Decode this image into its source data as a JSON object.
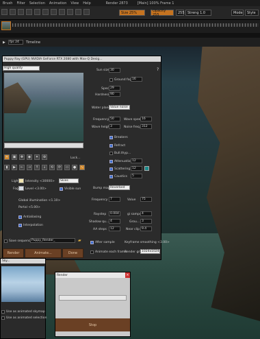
{
  "menu": [
    "Brush",
    "Filter",
    "Selection",
    "Animation",
    "View",
    "Help"
  ],
  "title": "Render 2873",
  "status": "[Main] 100% Frame 1",
  "toolbar": {
    "zoom": "Size 25%",
    "opacity": "Opacity 255",
    "num1": "255",
    "strength": "Streng 1.0",
    "mode": "Mode",
    "style": "Style"
  },
  "timeline": {
    "fps": "fps 24",
    "label": "Timeline"
  },
  "panel": {
    "title": "Puppy Ray (GPU) NVIDIA GeForce RTX 2080 with Max-Q Desig...",
    "quality": "High quality",
    "sun_size_label": "Sun size",
    "sun_size": "30",
    "ground_fog_label": "Ground fog",
    "ground_fog": "16",
    "spec_label": "Spec",
    "spec": "29",
    "hardness_label": "Hardness",
    "hardness": "90",
    "water_plane_label": "Water plane",
    "water_plane": "Value noise",
    "frequency_label": "Frequency",
    "frequency": "50",
    "wave_speed_label": "Wave speed",
    "wave_speed": "16",
    "wave_height_label": "Wave height",
    "wave_height": "3",
    "noise_freq_label": "Noise freq.",
    "noise_freq": "312",
    "breakers": "Breakers",
    "refract": "Refract",
    "bull": "Bull.thyp...",
    "attenuation_label": "Attenuation",
    "attenuation": "12",
    "scattering_label": "Scattering",
    "scattering": "12",
    "caustics_label": "Caustics",
    "caustics": "5",
    "bump_map_label": "Bump map",
    "bump_map": "Reverbed",
    "bfreq_label": "Frequency",
    "bfreq": "7",
    "bvalue_label": "Value",
    "bvalue": "75",
    "raystep_label": "Raystep",
    "raystep": "0.004",
    "gi_samps_label": "gi samps",
    "gi_samps": "4",
    "shadow_q_label": "Shadow qu...",
    "shadow_q": "4",
    "group_label": "Grou...",
    "group": "3",
    "aa_steps_label": "AA steps",
    "aa_steps": "12",
    "near_clip_label": "Near clip",
    "near_clip": "9.4",
    "light_label": "Light",
    "light_intensity": "Intensity <30000>",
    "fog_label": "Fog",
    "fog_level": "Level <3.00>",
    "sky_select": "Skies",
    "visible_sun": "Visible sun",
    "gi": "Global illumination <1.10>",
    "portal": "Portal <5.00>",
    "antialiasing": "Antialiasing",
    "interpolation": "Interpolation",
    "save_sequence": "Save sequence",
    "seq_name": "Puppy_Render_",
    "after_sample": "After sample",
    "keyframe_smoothing": "Keyframe smoothing <3.00>",
    "animate_each": "Animate each frame",
    "render_grid_label": "Render grid",
    "render_grid": "1024x1024",
    "lock": "Lock...",
    "render_btn": "Render",
    "animate_btn": "Animate...",
    "done_btn": "Done"
  },
  "sky": {
    "title": "Sky...",
    "animated_skymap": "Use as animated skymap",
    "animated_selection": "Use as animated selection"
  },
  "render": {
    "title": "Render",
    "stop": "Stop"
  }
}
